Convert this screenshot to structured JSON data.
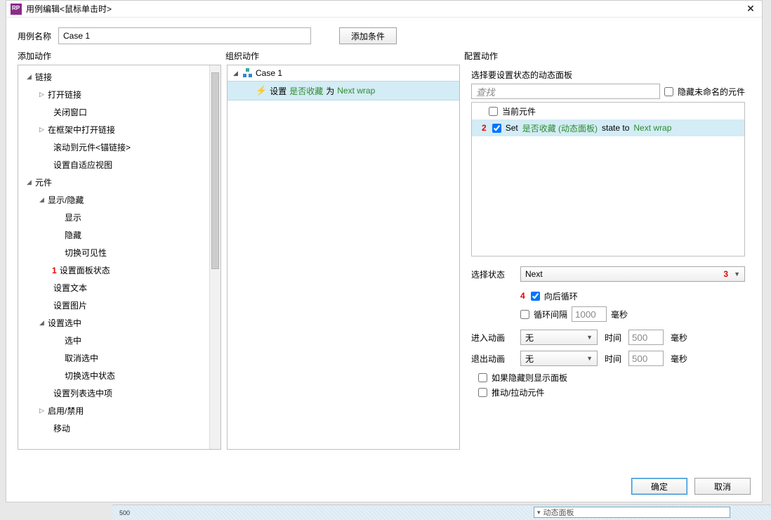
{
  "title": "用例编辑<鼠标单击时>",
  "use_case_name_label": "用例名称",
  "use_case_name_value": "Case 1",
  "add_condition_btn": "添加条件",
  "sections": {
    "add_action": "添加动作",
    "organize_action": "组织动作",
    "configure_action": "配置动作"
  },
  "tree": {
    "link": "链接",
    "open_link": "打开链接",
    "close_window": "关闭窗口",
    "open_in_frame": "在框架中打开链接",
    "scroll_to_anchor": "滚动到元件<锚链接>",
    "set_adaptive_view": "设置自适应视图",
    "widget": "元件",
    "show_hide": "显示/隐藏",
    "show": "显示",
    "hide": "隐藏",
    "toggle_vis": "切换可见性",
    "set_panel_state": "设置面板状态",
    "set_text": "设置文本",
    "set_image": "设置图片",
    "set_selected": "设置选中",
    "select": "选中",
    "deselect": "取消选中",
    "toggle_selected": "切换选中状态",
    "set_list_sel": "设置列表选中项",
    "enable_disable": "启用/禁用",
    "move": "移动"
  },
  "markers": {
    "m1": "1",
    "m2": "2",
    "m3": "3",
    "m4": "4"
  },
  "organize": {
    "case_name": "Case 1",
    "action_prefix": "设置 ",
    "action_target": "是否收藏",
    "action_mid": " 为 ",
    "action_value": "Next wrap"
  },
  "configure": {
    "select_panel_label": "选择要设置状态的动态面板",
    "search_placeholder": "查找",
    "hide_unnamed": "隐藏未命名的元件",
    "current_widget": "当前元件",
    "item_prefix": "Set ",
    "item_target": "是否收藏 (动态面板)",
    "item_mid": " state to ",
    "item_value": "Next wrap",
    "select_state_label": "选择状态",
    "select_state_value": "Next",
    "wrap_label": "向后循环",
    "repeat_label": "循环间隔",
    "repeat_value": "1000",
    "ms": "毫秒",
    "animate_in": "进入动画",
    "animate_out": "退出动画",
    "none": "无",
    "time_label": "时间",
    "time_value": "500",
    "show_if_hidden": "如果隐藏则显示面板",
    "push_pull": "推动/拉动元件"
  },
  "footer": {
    "ok": "确定",
    "cancel": "取消"
  },
  "canvas": {
    "ruler": "500",
    "dp_label": "动态面板"
  }
}
